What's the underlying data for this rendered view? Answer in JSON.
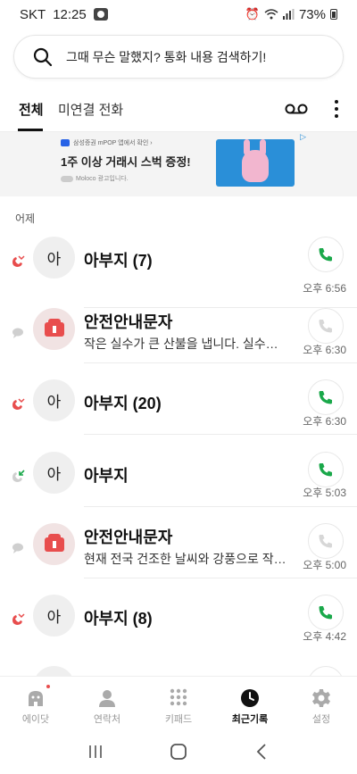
{
  "status_bar": {
    "carrier": "SKT",
    "time": "12:25",
    "battery": "73%"
  },
  "search": {
    "placeholder": "그때 무슨 말했지? 통화 내용 검색하기!"
  },
  "tabs": [
    {
      "label": "전체"
    },
    {
      "label": "미연결 전화"
    }
  ],
  "ad": {
    "tagline": "삼성증권 mPOP 앱에서 확인 ›",
    "title": "1주 이상 거래시 스벅 증정!",
    "meta": "Moloco 광고입니다.",
    "badge": "AD"
  },
  "section_label": "어제",
  "calls": [
    {
      "type": "missed",
      "avatar": "아",
      "name": "아부지 (7)",
      "subtitle": "",
      "time": "오후 6:56",
      "button_active": true
    },
    {
      "type": "message",
      "avatar": "alert",
      "name": "안전안내문자",
      "subtitle": "작은 실수가 큰 산불을 냅니다. 실수로 낸 산불도 처벌받습니다.",
      "time": "오후 6:30",
      "button_active": false
    },
    {
      "type": "missed",
      "avatar": "아",
      "name": "아부지 (20)",
      "subtitle": "",
      "time": "오후 6:30",
      "button_active": true
    },
    {
      "type": "incoming",
      "avatar": "아",
      "name": "아부지",
      "subtitle": "",
      "time": "오후 5:03",
      "button_active": true
    },
    {
      "type": "message",
      "avatar": "alert",
      "name": "안전안내문자",
      "subtitle": "현재 전국 건조한 날씨와 강풍으로 작은 불씨에도 산불 위험",
      "time": "오후 5:00",
      "button_active": false
    },
    {
      "type": "missed",
      "avatar": "아",
      "name": "아부지 (8)",
      "subtitle": "",
      "time": "오후 4:42",
      "button_active": true
    }
  ],
  "bottom_nav": [
    {
      "label": "에이닷",
      "icon": "adot-icon"
    },
    {
      "label": "연락처",
      "icon": "person-icon"
    },
    {
      "label": "키패드",
      "icon": "keypad-icon"
    },
    {
      "label": "최근기록",
      "icon": "clock-icon"
    },
    {
      "label": "설정",
      "icon": "gear-icon"
    }
  ],
  "colors": {
    "missed": "#e84d4d",
    "call_green": "#1aa84a",
    "incoming": "#1aa84a"
  }
}
